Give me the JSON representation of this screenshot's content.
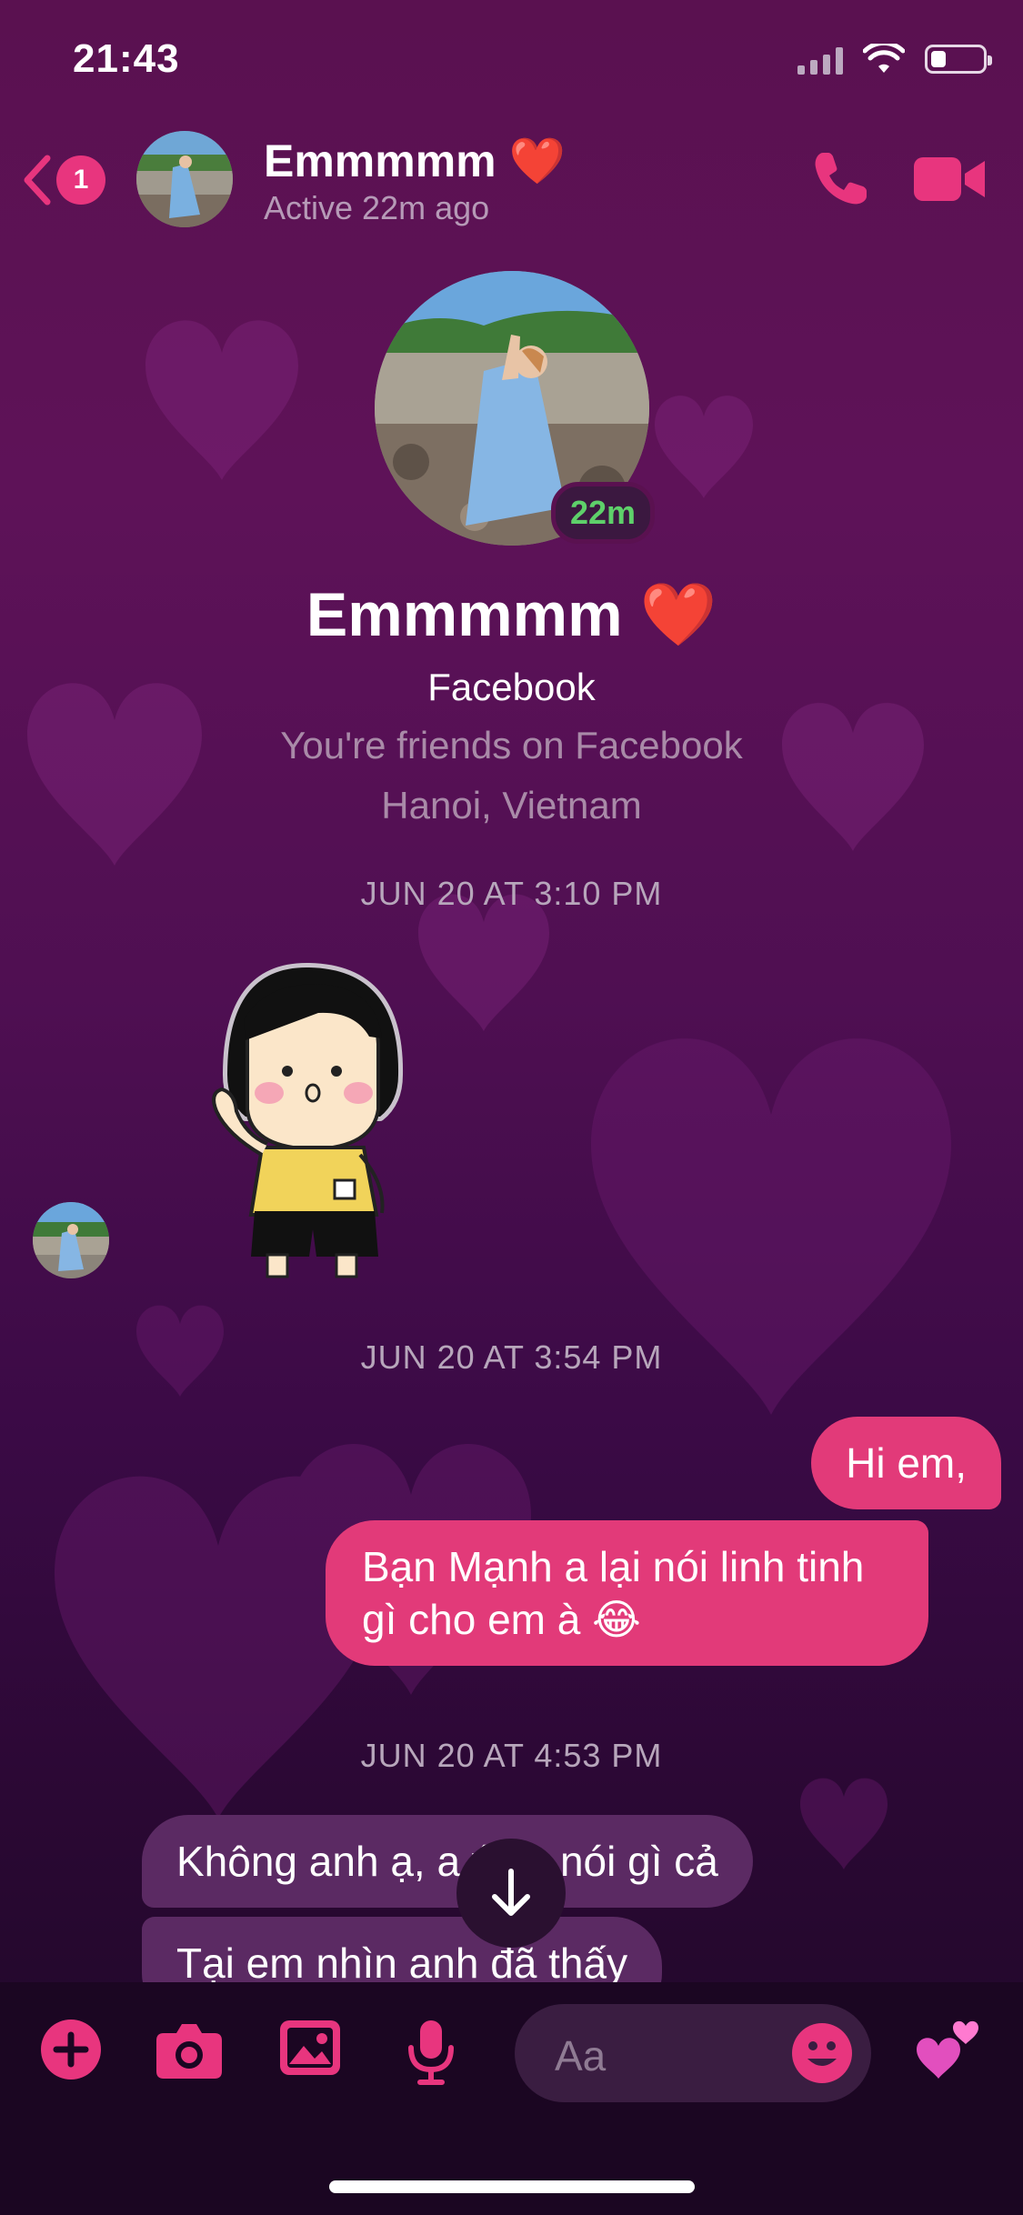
{
  "status_bar": {
    "time": "21:43"
  },
  "header": {
    "back_badge": "1",
    "name": "Emmmmm ❤️",
    "status": "Active 22m ago"
  },
  "profile": {
    "active_badge": "22m",
    "name": "Emmmmm ❤️",
    "source": "Facebook",
    "friends": "You're friends on Facebook",
    "location": "Hanoi, Vietnam"
  },
  "conversation": {
    "timestamps": [
      "JUN 20 AT 3:10 PM",
      "JUN 20 AT 3:54 PM",
      "JUN 20 AT 4:53 PM"
    ],
    "messages": [
      {
        "from": "me",
        "text": "Hi em,"
      },
      {
        "from": "me",
        "text": "Bạn Mạnh a lại nói linh tinh gì cho em à 😂"
      },
      {
        "from": "them",
        "text": "Không anh ạ, a ý ko nói gì cả"
      },
      {
        "from": "them",
        "text": "Tại em nhìn anh đã thấy"
      }
    ]
  },
  "composer": {
    "placeholder": "Aa",
    "icons": [
      "plus-icon",
      "camera-icon",
      "image-icon",
      "microphone-icon",
      "emoji-icon",
      "hearts-icon"
    ]
  },
  "colors": {
    "accent": "#e8357e",
    "outgoing_bubble": "#e23a79",
    "incoming_bubble": "#5b2a63",
    "active_green": "#5ed06a"
  }
}
